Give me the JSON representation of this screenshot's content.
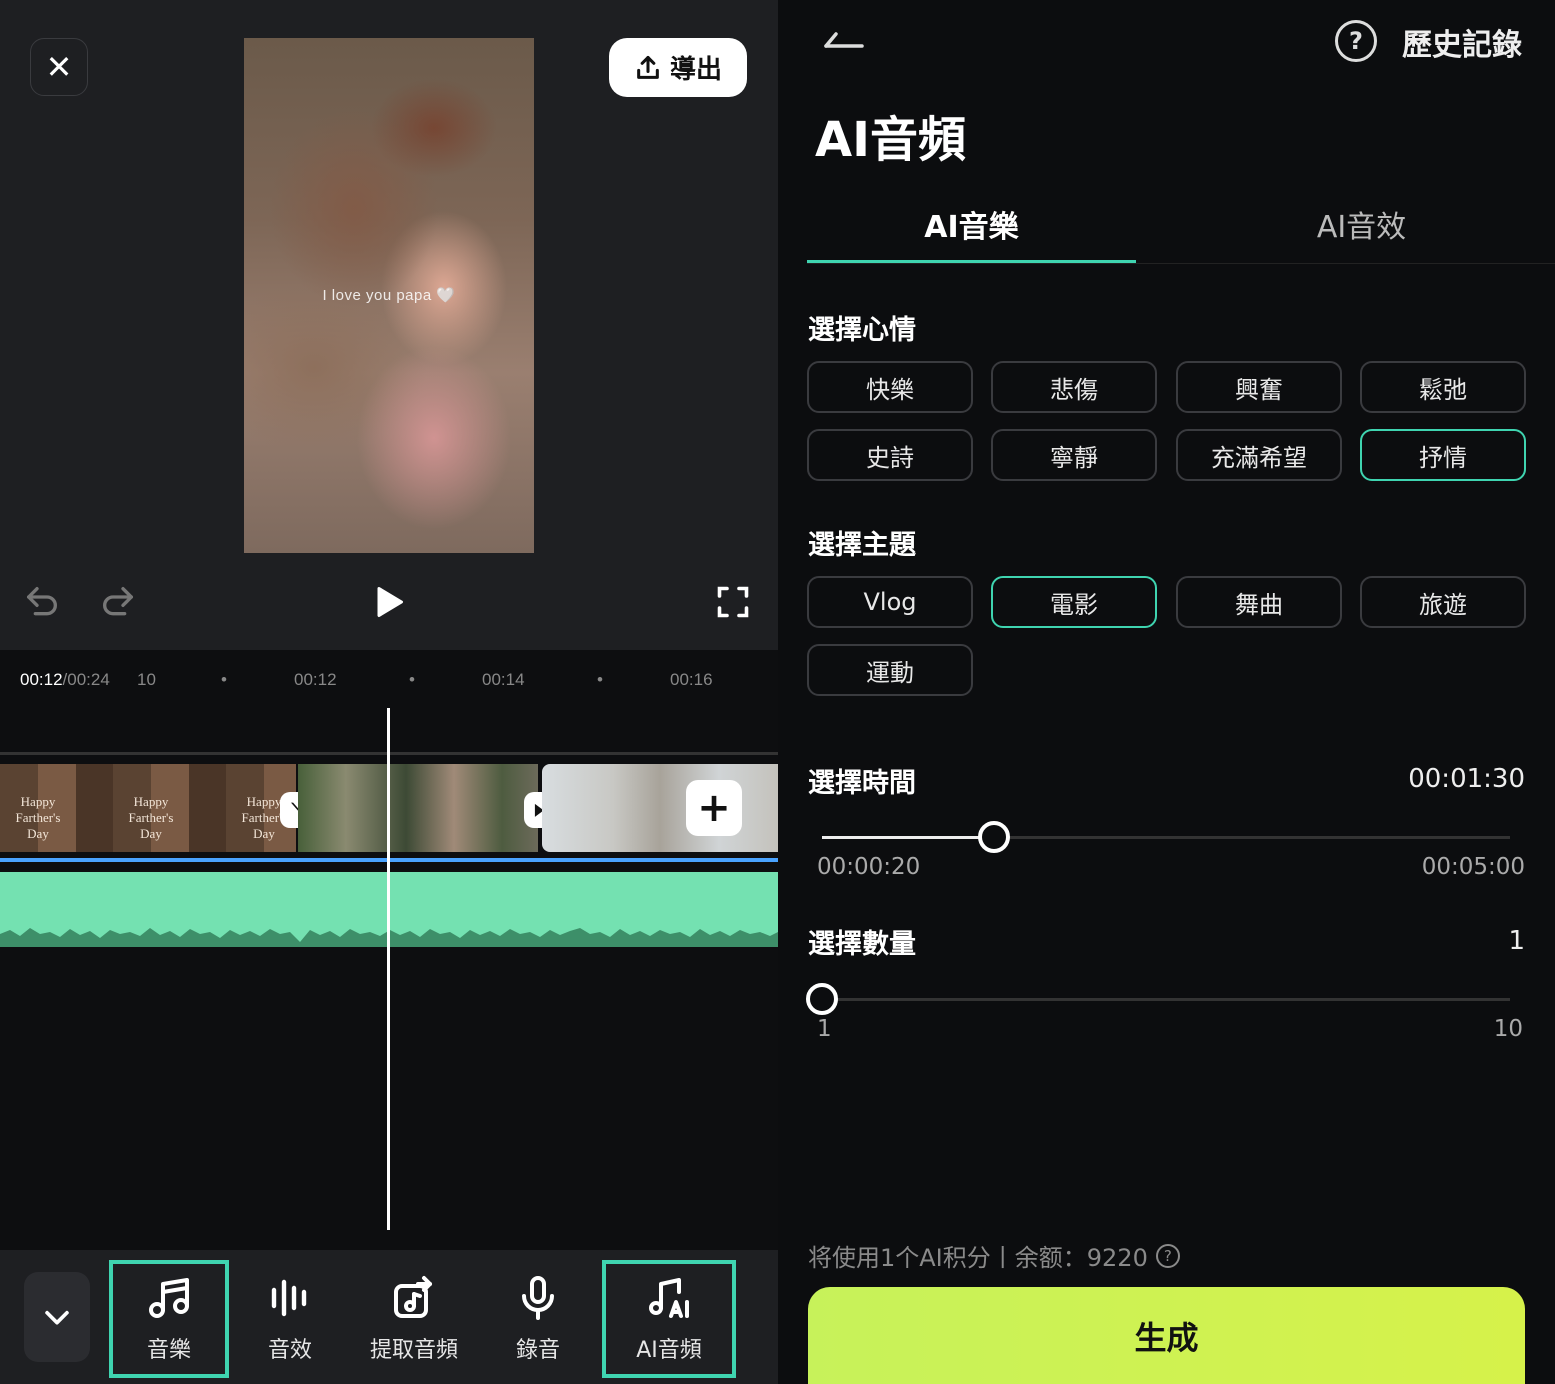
{
  "editor": {
    "export_label": "導出",
    "video_caption": "I love you papa 🤍",
    "timeline": {
      "current_time": "00:12",
      "total_time": "/00:24",
      "frame": "10",
      "ticks": [
        "00:12",
        "00:14",
        "00:16"
      ]
    },
    "clip_labels": [
      "Happy Farther's Day",
      "Happy Farther's Day",
      "Happy Farther's Day"
    ],
    "toolbar": {
      "items": [
        {
          "label": "音樂",
          "icon": "music-note-icon",
          "active": true
        },
        {
          "label": "音效",
          "icon": "sound-bars-icon",
          "active": false
        },
        {
          "label": "提取音頻",
          "icon": "extract-audio-icon",
          "active": false
        },
        {
          "label": "錄音",
          "icon": "microphone-icon",
          "active": false
        },
        {
          "label": "AI音頻",
          "icon": "ai-music-icon",
          "active": true
        }
      ]
    }
  },
  "panel": {
    "history_label": "歷史記錄",
    "title": "AI音頻",
    "tabs": [
      {
        "label": "AI音樂",
        "active": true
      },
      {
        "label": "AI音效",
        "active": false
      }
    ],
    "mood": {
      "title": "選擇心情",
      "options": [
        "快樂",
        "悲傷",
        "興奮",
        "鬆弛",
        "史詩",
        "寧靜",
        "充滿希望",
        "抒情"
      ],
      "selected": "抒情"
    },
    "theme": {
      "title": "選擇主題",
      "options": [
        "Vlog",
        "電影",
        "舞曲",
        "旅遊",
        "運動"
      ],
      "selected": "電影"
    },
    "duration": {
      "title": "選擇時間",
      "value": "00:01:30",
      "min_label": "00:00:20",
      "max_label": "00:05:00",
      "fraction": 0.25
    },
    "count": {
      "title": "選擇數量",
      "value": "1",
      "min_label": "1",
      "max_label": "10",
      "fraction": 0.0
    },
    "credit_text": "将使用1个AI积分丨余额：9220",
    "generate_label": "生成"
  },
  "colors": {
    "accent": "#3fd4b0",
    "audio_wave": "#74e1b1",
    "generate": "#d2f250",
    "timeline_marker": "#4aa3ff"
  }
}
